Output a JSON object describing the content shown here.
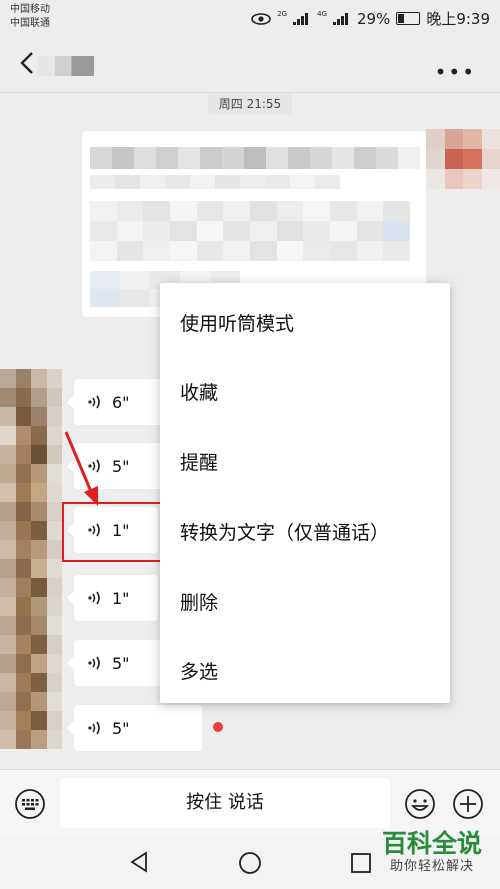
{
  "status": {
    "carrier_1": "中国移动",
    "carrier_2": "中国联通",
    "net_1": "2G",
    "net_2": "4G",
    "battery": "29%",
    "time": "晚上9:39"
  },
  "chat": {
    "timestamp": "周四 21:55",
    "voice_messages": [
      {
        "duration": "6\""
      },
      {
        "duration": "5\""
      },
      {
        "duration": "1\""
      },
      {
        "duration": "1\""
      },
      {
        "duration": "5\""
      },
      {
        "duration": "5\""
      }
    ]
  },
  "menu": {
    "items": [
      "使用听筒模式",
      "收藏",
      "提醒",
      "转换为文字（仅普通话）",
      "删除",
      "多选"
    ]
  },
  "input": {
    "hold_to_talk": "按住 说话"
  },
  "watermark": {
    "main": "百科全说",
    "sub": "助你轻松解决"
  },
  "colors": {
    "highlight": "#e02020",
    "unread_dot": "#ee3b3b",
    "watermark_green": "#2a8c3a"
  }
}
